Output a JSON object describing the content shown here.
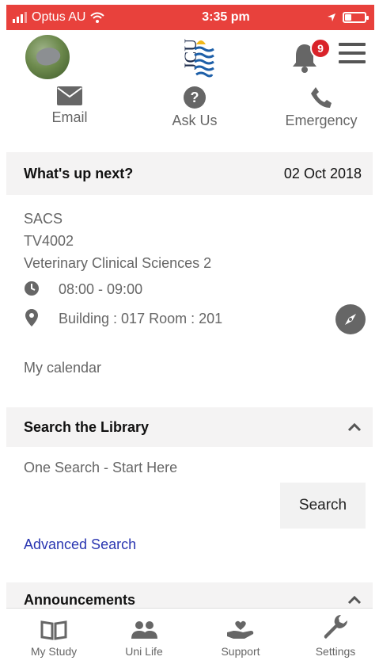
{
  "status_bar": {
    "carrier": "Optus AU",
    "time": "3:35 pm",
    "battery_level": 0.35,
    "background_color": "#e8413c"
  },
  "header": {
    "notification_count": "9",
    "logo_text": "JCU",
    "icons": {
      "avatar": "user-avatar",
      "bell": "bell-icon",
      "menu": "hamburger-menu-icon"
    }
  },
  "quick_actions": [
    {
      "label": "Email",
      "icon": "envelope-icon"
    },
    {
      "label": "Ask Us",
      "icon": "question-circle-icon"
    },
    {
      "label": "Emergency",
      "icon": "phone-icon"
    }
  ],
  "whats_up_next": {
    "title": "What's up next?",
    "date": "02 Oct 2018",
    "campus": "SACS",
    "subject_code": "TV4002",
    "subject_name": "Veterinary Clinical Sciences 2",
    "time": "08:00 - 09:00",
    "location": "Building : 017 Room : 201",
    "calendar_link": "My calendar"
  },
  "library": {
    "title": "Search the Library",
    "search_placeholder": "One Search - Start Here",
    "search_button": "Search",
    "advanced_link": "Advanced Search"
  },
  "announcements": {
    "title": "Announcements"
  },
  "tab_bar": [
    {
      "label": "My Study",
      "icon": "book-icon"
    },
    {
      "label": "Uni Life",
      "icon": "people-icon"
    },
    {
      "label": "Support",
      "icon": "hand-heart-icon"
    },
    {
      "label": "Settings",
      "icon": "wrench-icon"
    }
  ],
  "colors": {
    "accent_link": "#2a36b1",
    "badge": "#d9232a",
    "section_bg": "#f4f3f3"
  }
}
